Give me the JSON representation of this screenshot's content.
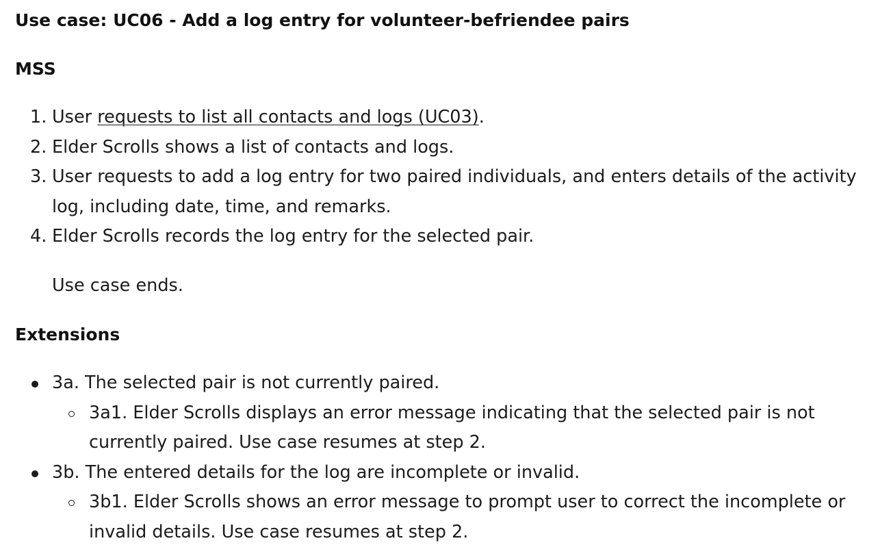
{
  "use_case": {
    "title": "Use case: UC06 - Add a log entry for volunteer-befriendee pairs",
    "mss_heading": "MSS",
    "steps": [
      {
        "number": "1.",
        "prefix": "User ",
        "link_text": "requests to list all contacts and logs (UC03)",
        "suffix": "."
      },
      {
        "number": "2.",
        "text": "Elder Scrolls shows a list of contacts and logs."
      },
      {
        "number": "3.",
        "text": "User requests to add a log entry for two paired individuals, and enters details of the activity log, including date, time, and remarks."
      },
      {
        "number": "4.",
        "text": "Elder Scrolls records the log entry for the selected pair."
      }
    ],
    "ends_text": "Use case ends.",
    "extensions_heading": "Extensions",
    "extensions": [
      {
        "text": "3a. The selected pair is not currently paired.",
        "sub": [
          "3a1. Elder Scrolls displays an error message indicating that the selected pair is not currently paired. Use case resumes at step 2."
        ]
      },
      {
        "text": "3b. The entered details for the log are incomplete or invalid.",
        "sub": [
          "3b1. Elder Scrolls shows an error message to prompt user to correct the incomplete or invalid details. Use case resumes at step 2."
        ]
      }
    ]
  }
}
